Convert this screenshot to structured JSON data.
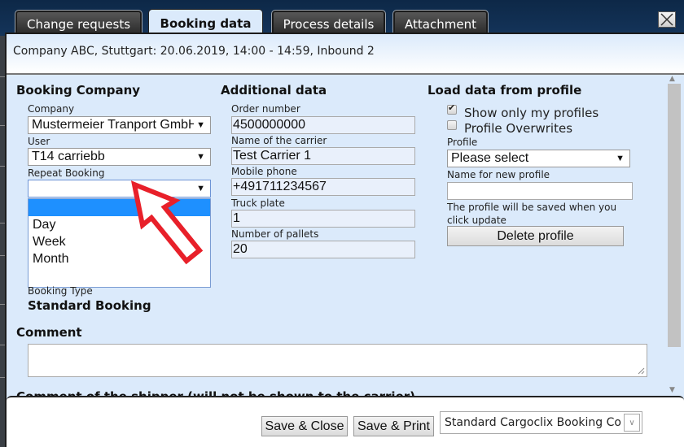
{
  "tabs": [
    {
      "label": "Change requests",
      "active": false
    },
    {
      "label": "Booking data",
      "active": true
    },
    {
      "label": "Process details",
      "active": false
    },
    {
      "label": "Attachment",
      "active": false
    }
  ],
  "header": {
    "text": "Company ABC, Stuttgart: 20.06.2019, 14:00 - 14:59, Inbound 2"
  },
  "booking_company": {
    "heading": "Booking Company",
    "company_label": "Company",
    "company_value": "Mustermeier Tranport GmbH",
    "user_label": "User",
    "user_value": "T14 carriebb",
    "repeat_label": "Repeat Booking",
    "repeat_value": "",
    "repeat_options": [
      "",
      "Day",
      "Week",
      "Month"
    ],
    "booking_type_label": "Booking Type",
    "booking_type_value": "Standard Booking"
  },
  "additional_data": {
    "heading": "Additional data",
    "fields": [
      {
        "label": "Order number",
        "value": "4500000000"
      },
      {
        "label": "Name of the carrier",
        "value": "Test Carrier 1"
      },
      {
        "label": "Mobile phone",
        "value": "+491711234567"
      },
      {
        "label": "Truck plate",
        "value": "1"
      },
      {
        "label": "Number of pallets",
        "value": "20"
      }
    ]
  },
  "profile": {
    "heading": "Load data from profile",
    "show_only_mine_label": "Show only my profiles",
    "show_only_mine_checked": true,
    "overwrites_label": "Profile Overwrites",
    "overwrites_checked": false,
    "profile_label": "Profile",
    "profile_value": "Please select",
    "new_name_label": "Name for new profile",
    "new_name_value": "",
    "hint": "The profile will be saved when you click update",
    "delete_label": "Delete profile"
  },
  "comment": {
    "heading": "Comment",
    "value": "",
    "shipper_heading": "Comment of the shipper (will not be shown to the carrier)"
  },
  "footer": {
    "save_close": "Save & Close",
    "save_print": "Save & Print",
    "print_template": "Standard Cargoclix Booking Confirmation"
  },
  "colors": {
    "highlight": "#1e90ff",
    "panel": "#dbeafb",
    "annotation_arrow": "#e8202a"
  }
}
